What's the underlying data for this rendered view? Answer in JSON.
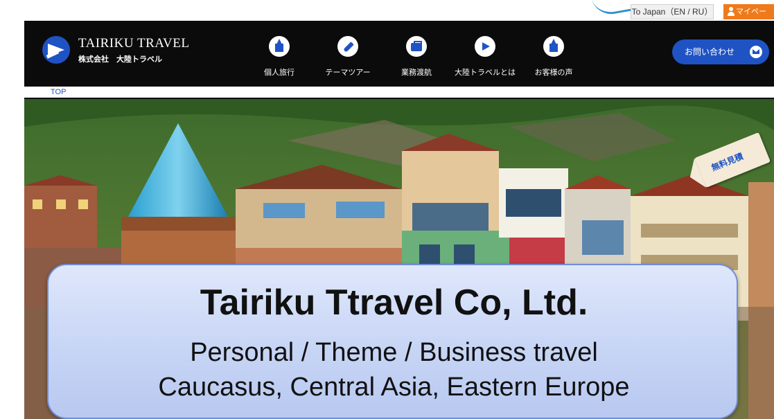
{
  "topbar": {
    "language_link": "To Japan（EN / RU）",
    "mypage_label": "マイペー"
  },
  "header": {
    "brand_en": "TAIRIKU TRAVEL",
    "brand_ja": "株式会社　大陸トラベル",
    "nav": [
      {
        "label": "個人旅行",
        "icon": "church-icon"
      },
      {
        "label": "テーマツアー",
        "icon": "rocket-icon"
      },
      {
        "label": "業務渡航",
        "icon": "briefcase-icon"
      },
      {
        "label": "大陸トラベルとは",
        "icon": "plane-icon"
      },
      {
        "label": "お客様の声",
        "icon": "church-icon"
      }
    ],
    "contact_label": "お問い合わせ"
  },
  "breadcrumb": {
    "top": "TOP"
  },
  "hero": {
    "quote_tag": "無料見積"
  },
  "callout": {
    "title": "Tairiku Ttravel Co, Ltd.",
    "line1": "Personal / Theme / Business travel",
    "line2": "Caucasus, Central Asia, Eastern Europe"
  },
  "colors": {
    "brand_blue": "#1f53c4",
    "accent_orange": "#ef7a1b",
    "callout_bg": "#c7d5f5"
  }
}
